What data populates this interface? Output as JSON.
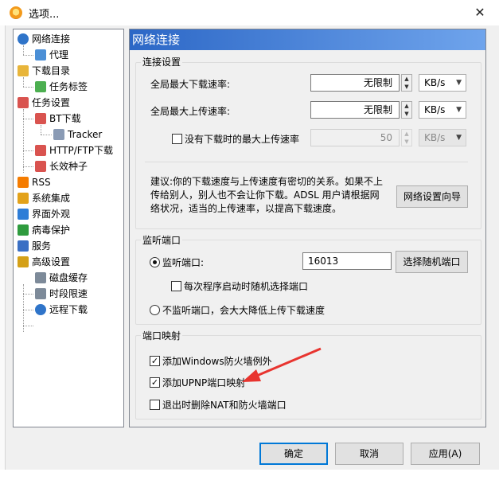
{
  "window": {
    "title": "选项...",
    "close_glyph": "✕"
  },
  "tree": [
    {
      "label": "网络连接",
      "icon": "globe-icon",
      "color": "#2f74c9"
    },
    {
      "label": "代理",
      "icon": "network-icon",
      "color": "#4b8fd6"
    },
    {
      "label": "下载目录",
      "icon": "folder-icon",
      "color": "#e8b53a"
    },
    {
      "label": "任务标签",
      "icon": "tag-icon",
      "color": "#4caf50"
    },
    {
      "label": "任务设置",
      "icon": "clipboard-icon",
      "color": "#d9534f"
    },
    {
      "label": "BT下载",
      "icon": "clipboard-icon",
      "color": "#d9534f"
    },
    {
      "label": "Tracker",
      "icon": "server-icon",
      "color": "#8a9bb5"
    },
    {
      "label": "HTTP/FTP下载",
      "icon": "clipboard-icon",
      "color": "#d9534f"
    },
    {
      "label": "长效种子",
      "icon": "clipboard-icon",
      "color": "#d9534f"
    },
    {
      "label": "RSS",
      "icon": "rss-icon",
      "color": "#f57c00"
    },
    {
      "label": "系统集成",
      "icon": "integration-icon",
      "color": "#e3a21a"
    },
    {
      "label": "界面外观",
      "icon": "palette-icon",
      "color": "#2e7dd7"
    },
    {
      "label": "病毒保护",
      "icon": "shield-icon",
      "color": "#2e9b3e"
    },
    {
      "label": "服务",
      "icon": "service-icon",
      "color": "#3a6fc4"
    },
    {
      "label": "高级设置",
      "icon": "advanced-icon",
      "color": "#d4a017"
    },
    {
      "label": "磁盘缓存",
      "icon": "disk-icon",
      "color": "#7d8a99"
    },
    {
      "label": "时段限速",
      "icon": "clock-icon",
      "color": "#7d8a99"
    },
    {
      "label": "远程下载",
      "icon": "remote-icon",
      "color": "#2f74c9"
    }
  ],
  "panel": {
    "header": "网络连接",
    "conn": {
      "legend": "连接设置",
      "max_down_label": "全局最大下载速率:",
      "max_down_value": "无限制",
      "max_down_unit": "KB/s",
      "max_up_label": "全局最大上传速率:",
      "max_up_value": "无限制",
      "max_up_unit": "KB/s",
      "idle_up_label": "没有下载时的最大上传速率",
      "idle_up_value": "50",
      "idle_up_unit": "KB/s",
      "advice_line1": "建议:你的下载速度与上传速度有密切的关系。如果不上",
      "advice_line2": "传给别人，别人也不会让你下载。ADSL 用户请根据网",
      "advice_line3": "络状况，适当的上传速率，以提高下载速度。",
      "wizard_button": "网络设置向导"
    },
    "listen": {
      "legend": "监听端口",
      "port_label": "监听端口:",
      "port_value": "16013",
      "random_button": "选择随机端口",
      "random_each_start": "每次程序启动时随机选择端口",
      "no_listen_label": "不监听端口，会大大降低上传下载速度"
    },
    "mapping": {
      "legend": "端口映射",
      "firewall_exception": "添加Windows防火墙例外",
      "upnp": "添加UPNP端口映射",
      "remove_on_exit": "退出时删除NAT和防火墙端口"
    }
  },
  "buttons": {
    "ok": "确定",
    "cancel": "取消",
    "apply": "应用(A)"
  },
  "colors": {
    "header_start": "#2c67c6",
    "header_end": "#6fa4ec",
    "arrow": "#e8342f",
    "default_button_border": "#0078d7"
  }
}
